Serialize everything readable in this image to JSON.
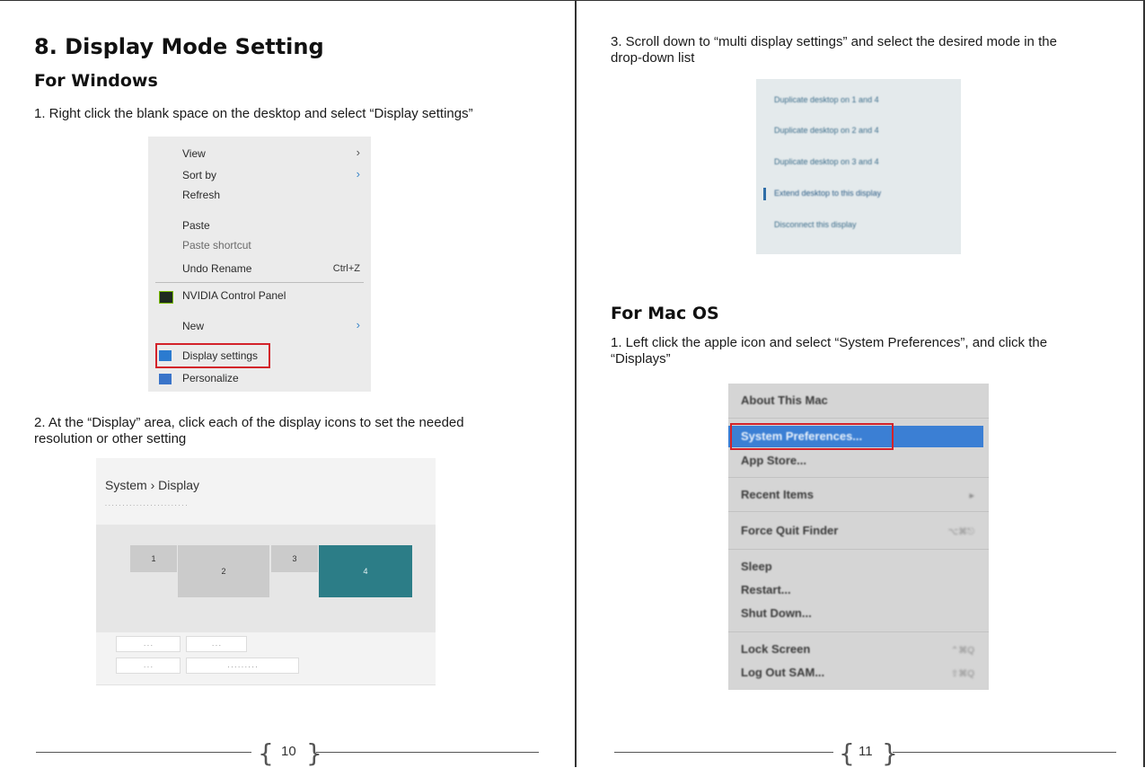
{
  "left_page": {
    "heading": "8.  Display Mode Setting",
    "subheading": "For Windows",
    "step1": "1. Right click the blank space on the desktop and select “Display settings”",
    "context_menu": {
      "items": [
        "View",
        "Sort by",
        "Refresh",
        "Paste",
        "Paste shortcut",
        "Undo Rename",
        "NVIDIA Control Panel",
        "New",
        "Display settings",
        "Personalize"
      ],
      "undo_shortcut": "Ctrl+Z"
    },
    "step2_line1": "2. At the “Display” area, click each of the display icons to set the needed",
    "step2_line2": "resolution or other setting",
    "display_settings": {
      "title": "System  ›  Display",
      "monitors": [
        "1",
        "2",
        "3",
        "4"
      ]
    },
    "page_number": "10"
  },
  "right_page": {
    "step3_line1": "3. Scroll down to “multi display settings” and select the desired mode in the",
    "step3_line2": "drop-down list",
    "dropdown_options": [
      "Duplicate desktop on 1 and 4",
      "Duplicate desktop on 2 and 4",
      "Duplicate desktop on 3 and 4",
      "Extend desktop to this display",
      "Disconnect this display"
    ],
    "subheading": "For Mac OS",
    "mac_step1_line1": "1. Left click the apple icon and select “System Preferences”, and click the",
    "mac_step1_line2": "“Displays”",
    "mac_menu": {
      "items": [
        "About This Mac",
        "System Preferences...",
        "App Store...",
        "Recent Items",
        "Force Quit Finder",
        "Sleep",
        "Restart...",
        "Shut Down...",
        "Lock Screen",
        "Log Out SAM..."
      ]
    },
    "page_number": "11"
  },
  "colors": {
    "highlight_red": "#d3222a",
    "active_monitor": "#2c7d87",
    "mac_selection": "#3b7fd4"
  }
}
